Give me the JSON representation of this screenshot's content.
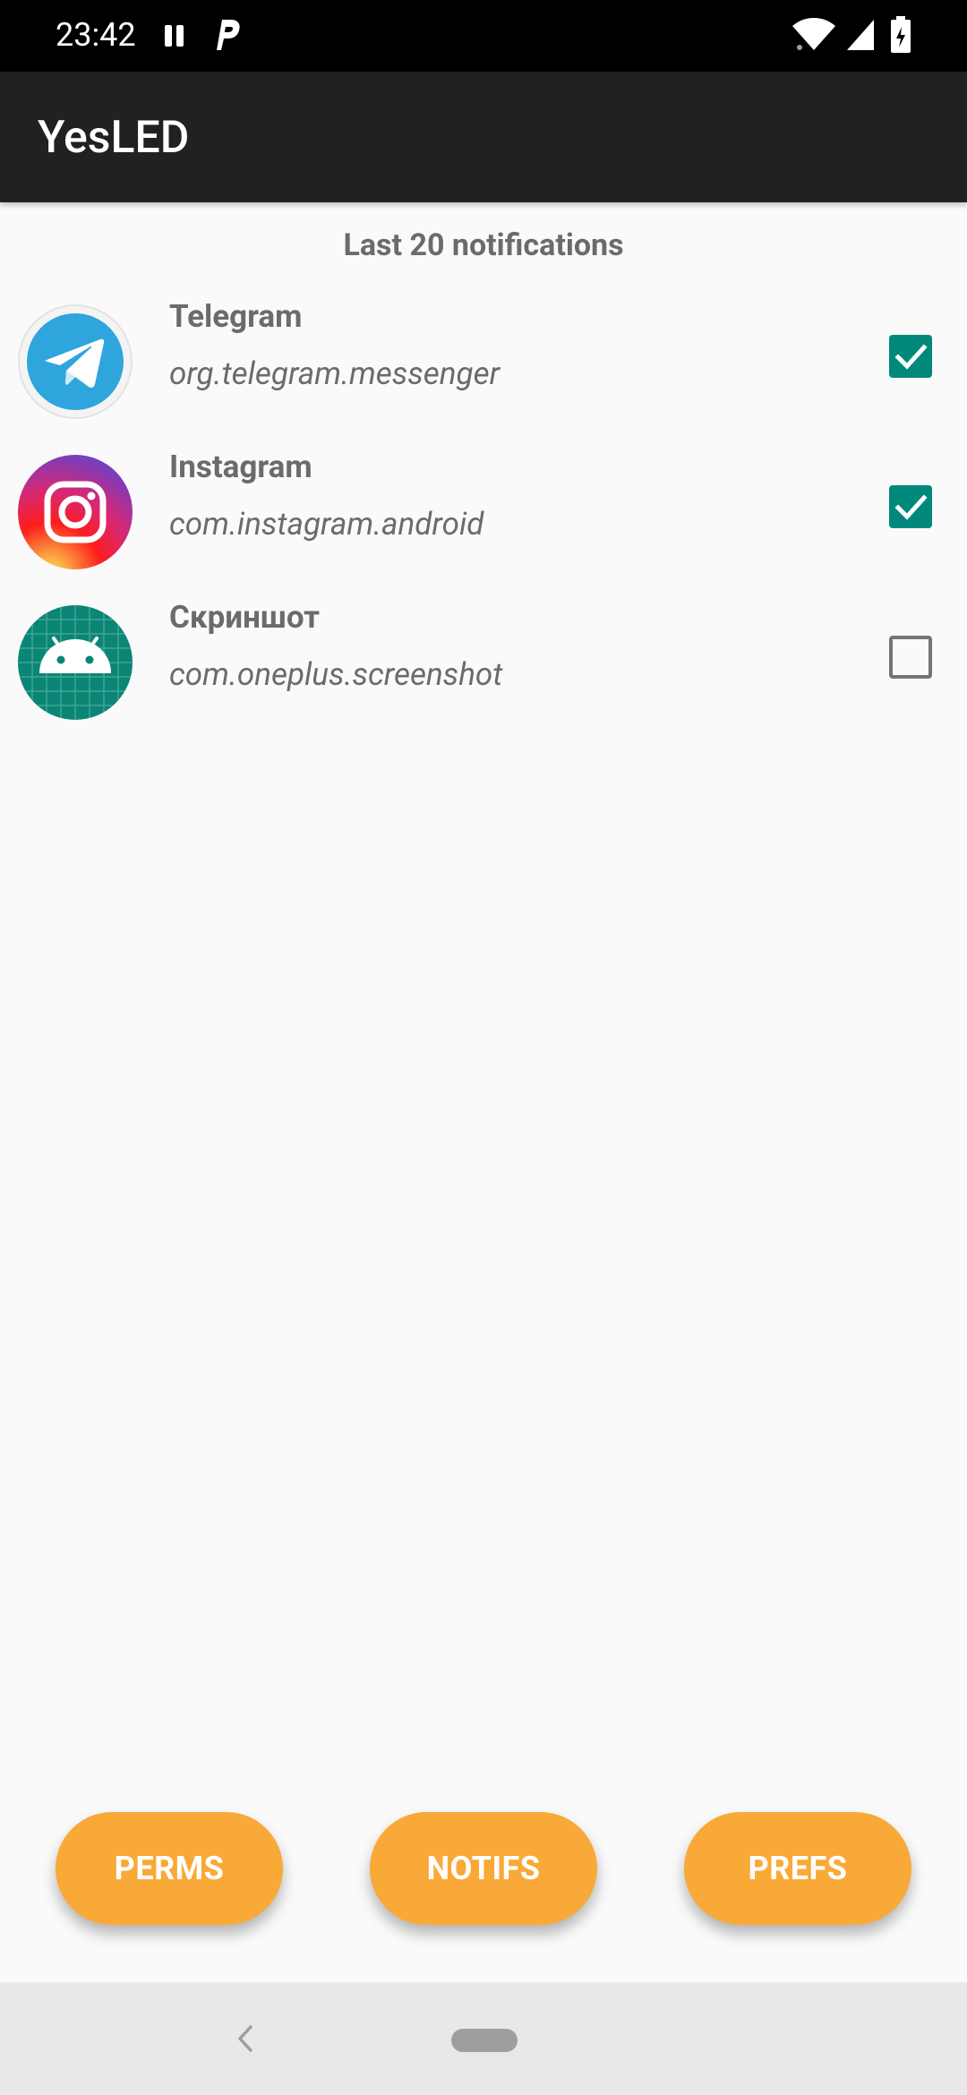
{
  "status_bar": {
    "time": "23:42",
    "icons": [
      "pause-icon",
      "parking-p-icon",
      "wifi-icon",
      "cell-signal-icon",
      "battery-charging-icon"
    ]
  },
  "app_bar": {
    "title": "YesLED"
  },
  "list": {
    "header": "Last 20 notifications",
    "items": [
      {
        "name": "Telegram",
        "package": "org.telegram.messenger",
        "checked": true,
        "icon": "telegram-icon"
      },
      {
        "name": "Instagram",
        "package": "com.instagram.android",
        "checked": true,
        "icon": "instagram-icon"
      },
      {
        "name": "Скриншот",
        "package": "com.oneplus.screenshot",
        "checked": false,
        "icon": "android-icon"
      }
    ]
  },
  "buttons": {
    "perms": "PERMS",
    "notifs": "NOTIFS",
    "prefs": "PREFS"
  },
  "colors": {
    "accent_button": "#f9a937",
    "checkbox_checked": "#00897b",
    "app_bar": "#212121",
    "text_secondary": "#6b6b6b"
  },
  "nav_bar": {
    "icons": [
      "back-chevron-icon",
      "home-pill-icon"
    ]
  }
}
